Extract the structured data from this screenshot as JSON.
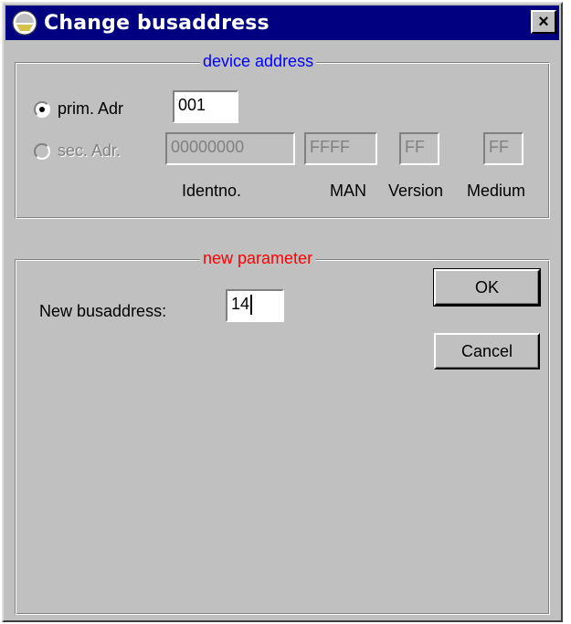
{
  "window": {
    "title": "Change busaddress",
    "close_glyph": "×",
    "icon": "app-icon"
  },
  "device_address": {
    "legend": "device address",
    "legend_color": "#0000ff",
    "prim": {
      "label": "prim. Adr",
      "value": "001",
      "selected": true
    },
    "sec": {
      "label": "sec. Adr.",
      "selected": false,
      "disabled": true,
      "identno": "00000000",
      "man": "FFFF",
      "version": "FF",
      "medium": "FF"
    },
    "column_labels": {
      "identno": "Identno.",
      "man": "MAN",
      "version": "Version",
      "medium": "Medium"
    }
  },
  "new_parameter": {
    "legend": "new parameter",
    "legend_color": "#ff0000",
    "busaddress_label": "New busaddress:",
    "busaddress_value": "14"
  },
  "buttons": {
    "ok": "OK",
    "cancel": "Cancel"
  }
}
